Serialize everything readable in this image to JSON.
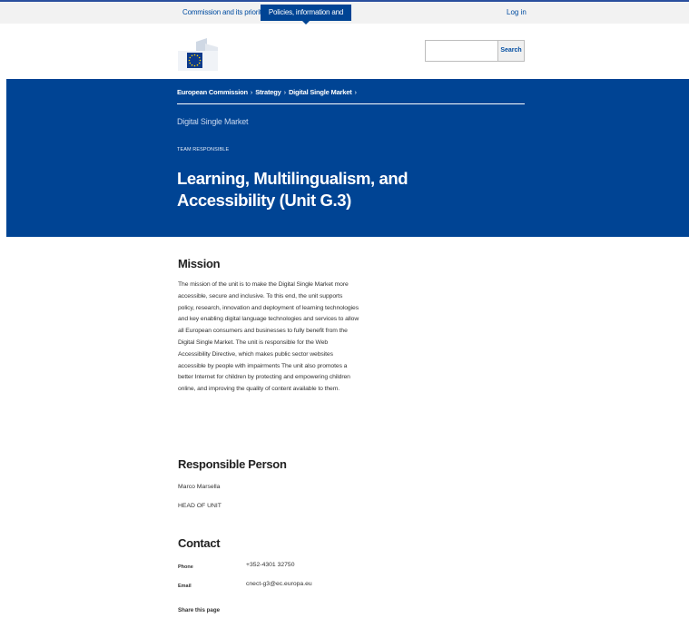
{
  "topbar": {
    "tab_commission": "Commission and its priorities",
    "tab_policies": "Policies, information and services",
    "login": "Log in"
  },
  "search": {
    "button": "Search",
    "placeholder": ""
  },
  "breadcrumb": {
    "items": [
      "European Commission",
      "Strategy",
      "Digital Single Market"
    ],
    "separator": "›"
  },
  "banner": {
    "site_name": "Digital Single Market",
    "meta": "TEAM RESPONSIBLE",
    "title": "Learning, Multilingualism, and Accessibility (Unit G.3)"
  },
  "mission": {
    "heading": "Mission",
    "text": "The mission of the unit is to make the Digital Single Market more accessible, secure and inclusive. To this end, the unit supports policy, research, innovation and deployment of learning technologies and key enabling digital language technologies and services to allow all European consumers and businesses to fully benefit from the Digital Single Market. The unit is responsible for the Web Accessibility Directive, which makes public sector websites accessible by people with impairments The unit also promotes a better Internet for children by protecting and empowering children online, and improving the quality of content available to them."
  },
  "responsible": {
    "heading": "Responsible Person",
    "name": "Marco Marsella",
    "role": "HEAD OF UNIT"
  },
  "contact": {
    "heading": "Contact",
    "phone_label": "Phone",
    "phone": "+352-4301 32750",
    "email_label": "Email",
    "email": "cnect-g3@ec.europa.eu"
  },
  "share": "Share this page",
  "colors": {
    "banner": "#004494",
    "link": "#034ea2"
  }
}
